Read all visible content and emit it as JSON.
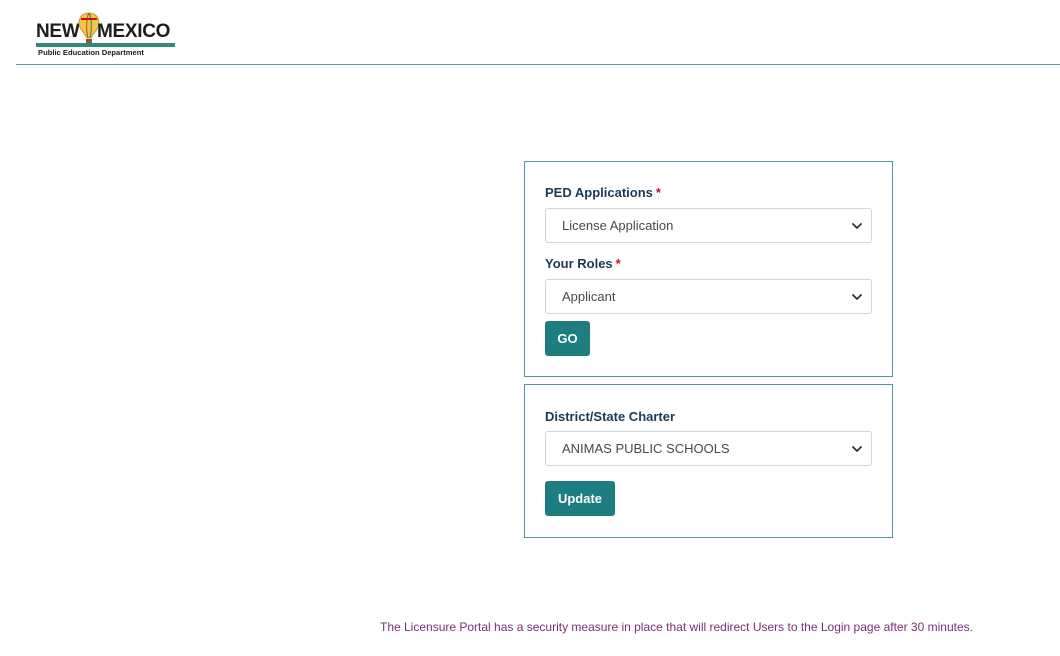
{
  "header": {
    "logo": {
      "word_left": "NEW",
      "word_right": "MEXICO",
      "subtitle": "Public Education Department"
    }
  },
  "card_applications": {
    "ped_applications_label": "PED Applications",
    "ped_applications_required": "*",
    "ped_applications_value": "License Application",
    "your_roles_label": "Your Roles",
    "your_roles_required": "*",
    "your_roles_value": "Applicant",
    "go_label": "GO"
  },
  "card_district": {
    "district_label": "District/State Charter",
    "district_value": "ANIMAS PUBLIC SCHOOLS",
    "update_label": "Update"
  },
  "footer": {
    "security_note": "The Licensure Portal has a security measure in place that will redirect Users to the Login page after 30 minutes."
  },
  "colors": {
    "accent": "#1e7d80",
    "card_border": "#4f95a1",
    "label": "#1b3a57",
    "required": "#c8102e",
    "note": "#7a2f78"
  },
  "icons": {
    "select_arrow": "chevron-down-icon",
    "logo_emblem": "hot-air-balloon-icon"
  }
}
